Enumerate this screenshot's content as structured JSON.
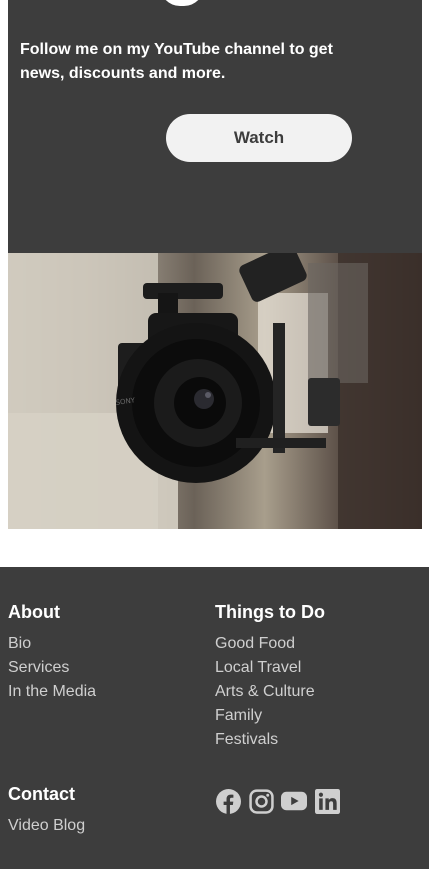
{
  "promo": {
    "text": "Follow me on my YouTube channel to get news, discounts and more.",
    "watch_label": "Watch"
  },
  "photo": {
    "subject": "camera-image",
    "lens_brand": "SONY"
  },
  "footer": {
    "about": {
      "heading": "About",
      "links": [
        "Bio",
        "Services",
        "In the Media"
      ]
    },
    "things": {
      "heading": "Things to Do",
      "links": [
        "Good Food",
        "Local Travel",
        "Arts & Culture",
        "Family",
        "Festivals"
      ]
    },
    "contact": {
      "heading": "Contact",
      "links": [
        "Video Blog"
      ]
    },
    "social": [
      "facebook-icon",
      "instagram-icon",
      "youtube-icon",
      "linkedin-icon"
    ]
  },
  "colors": {
    "dark_bg": "#3d3d3d",
    "button_bg": "#f2f2f2",
    "link": "#cfcfcf"
  }
}
